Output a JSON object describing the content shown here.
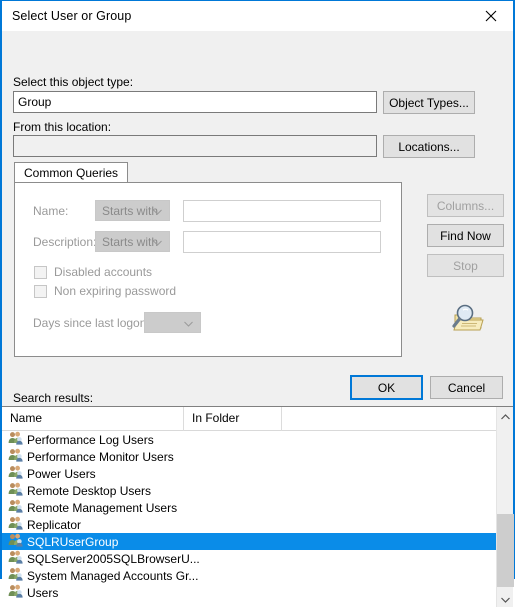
{
  "window": {
    "title": "Select User or Group",
    "close_icon": "close-icon"
  },
  "object_type": {
    "label": "Select this object type:",
    "value": "Group",
    "button_label": "Object Types..."
  },
  "location": {
    "label": "From this location:",
    "value": "",
    "button_label": "Locations..."
  },
  "tabs": [
    {
      "label": "Common Queries",
      "active": true
    }
  ],
  "query": {
    "name_label": "Name:",
    "name_operator": "Starts with",
    "name_value": "",
    "description_label": "Description:",
    "description_operator": "Starts with",
    "description_value": "",
    "disabled_accounts_label": "Disabled accounts",
    "disabled_accounts_checked": false,
    "non_expiring_password_label": "Non expiring password",
    "non_expiring_password_checked": false,
    "days_since_logon_label": "Days since last logon:",
    "days_since_logon_value": ""
  },
  "side_buttons": {
    "columns_label": "Columns...",
    "columns_enabled": false,
    "find_now_label": "Find Now",
    "find_now_enabled": true,
    "stop_label": "Stop",
    "stop_enabled": false,
    "search_icon": "magnifier-folder-icon"
  },
  "dialog_buttons": {
    "ok_label": "OK",
    "cancel_label": "Cancel",
    "default_button": "OK"
  },
  "results": {
    "label": "Search results:",
    "columns": [
      "Name",
      "In Folder",
      ""
    ],
    "selected_index": 6,
    "rows": [
      {
        "name": "Performance Log Users",
        "in_folder": ""
      },
      {
        "name": "Performance Monitor Users",
        "in_folder": ""
      },
      {
        "name": "Power Users",
        "in_folder": ""
      },
      {
        "name": "Remote Desktop Users",
        "in_folder": ""
      },
      {
        "name": "Remote Management Users",
        "in_folder": ""
      },
      {
        "name": "Replicator",
        "in_folder": ""
      },
      {
        "name": "SQLRUserGroup",
        "in_folder": ""
      },
      {
        "name": "SQLServer2005SQLBrowserU...",
        "in_folder": ""
      },
      {
        "name": "System Managed Accounts Gr...",
        "in_folder": ""
      },
      {
        "name": "Users",
        "in_folder": ""
      }
    ]
  },
  "colors": {
    "accent": "#0078d7",
    "selection": "#0a8ce8",
    "dialog_bg": "#f0f0f0",
    "disabled_text": "#9a9a9a"
  }
}
